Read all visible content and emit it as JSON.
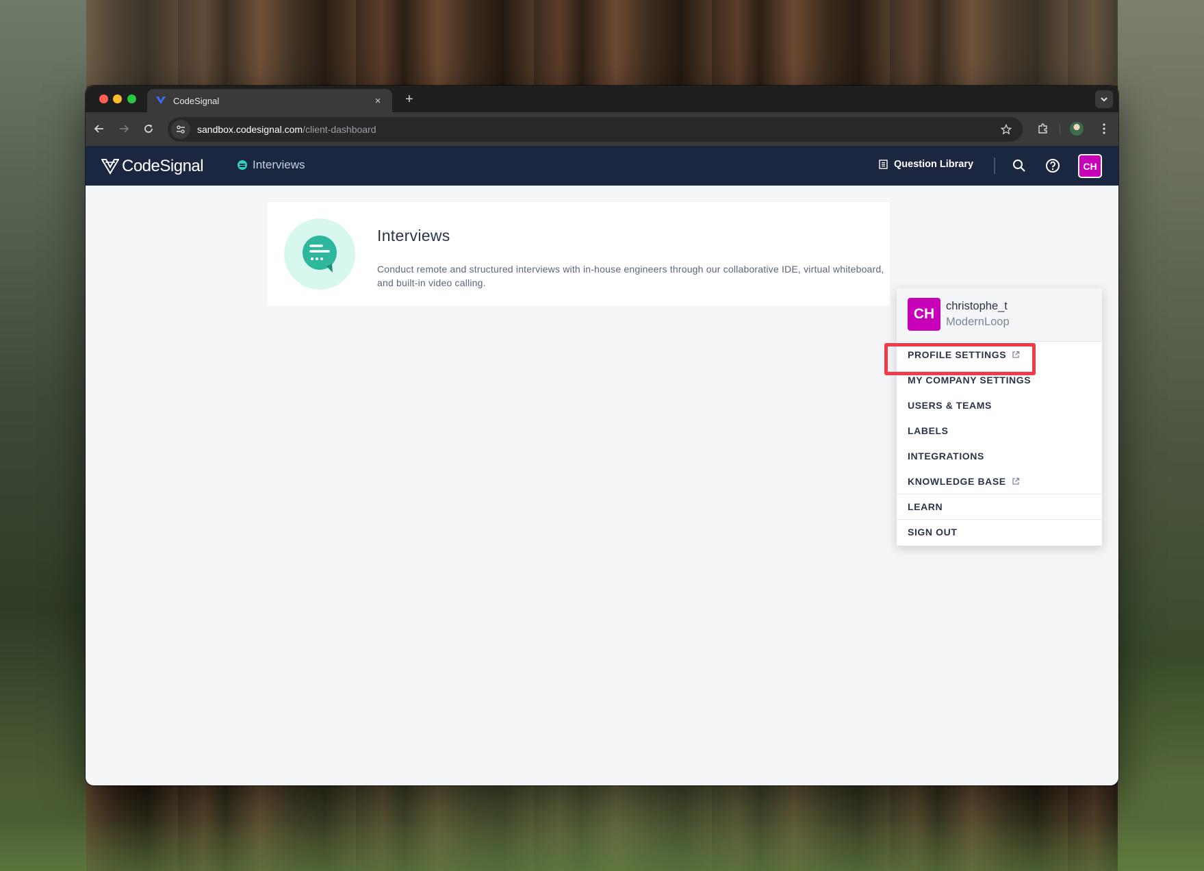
{
  "browser": {
    "tab_title": "CodeSignal",
    "tab_close": "×",
    "new_tab": "+",
    "url_host": "sandbox.codesignal.com",
    "url_path": "/client-dashboard"
  },
  "header": {
    "logo_text": "CodeSignal",
    "nav_interviews": "Interviews",
    "question_library": "Question Library",
    "avatar_initials": "CH"
  },
  "card": {
    "title": "Interviews",
    "description": "Conduct remote and structured interviews with in-house engineers through our collaborative IDE, virtual whiteboard, and built-in video calling."
  },
  "menu": {
    "avatar_initials": "CH",
    "username": "christophe_t",
    "company": "ModernLoop",
    "items": [
      {
        "label": "PROFILE SETTINGS"
      },
      {
        "label": "MY COMPANY SETTINGS"
      },
      {
        "label": "USERS & TEAMS"
      },
      {
        "label": "LABELS"
      },
      {
        "label": "INTEGRATIONS"
      },
      {
        "label": "KNOWLEDGE BASE"
      },
      {
        "label": "LEARN"
      },
      {
        "label": "SIGN OUT"
      }
    ]
  },
  "colors": {
    "header_bg": "#1b2641",
    "accent_teal": "#2ed3b7",
    "avatar_magenta": "#c800b8",
    "highlight_red": "#f23a4a"
  },
  "icons": {
    "back": "back-arrow-icon",
    "forward": "forward-arrow-icon",
    "reload": "reload-icon",
    "site_settings": "tune-icon",
    "bookmark": "star-icon",
    "extensions": "puzzle-icon",
    "menu": "kebab-menu-icon",
    "search": "search-icon",
    "help": "help-circle-icon",
    "library": "book-icon",
    "external": "external-link-icon",
    "chat": "chat-bubble-icon"
  }
}
